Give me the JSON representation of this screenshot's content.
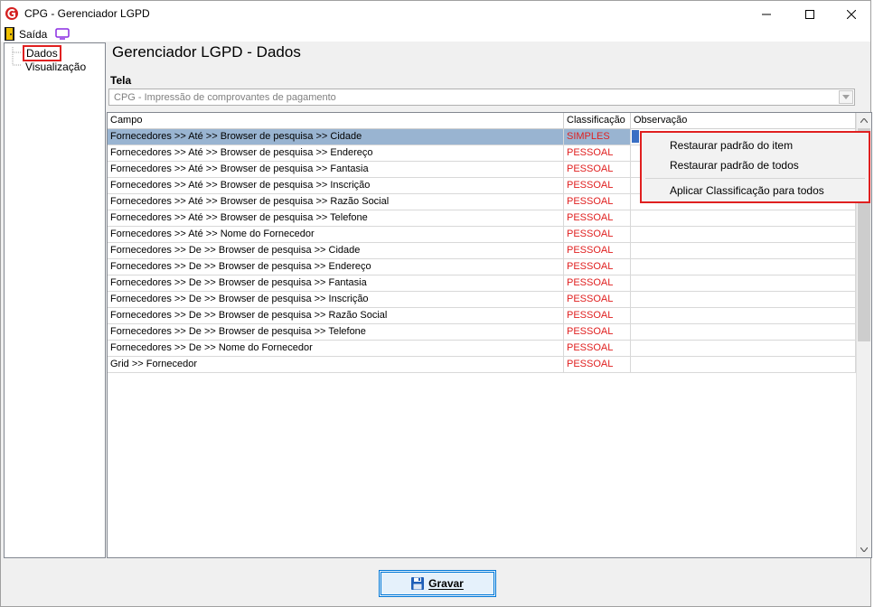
{
  "window": {
    "title": "CPG - Gerenciador LGPD"
  },
  "menubar": {
    "exit_label": "Saída"
  },
  "tree": {
    "items": [
      "Dados",
      "Visualização"
    ]
  },
  "page": {
    "title": "Gerenciador LGPD - Dados"
  },
  "tela": {
    "label": "Tela",
    "value": "CPG - Impressão de comprovantes de pagamento"
  },
  "grid": {
    "columns": [
      "Campo",
      "Classificação",
      "Observação"
    ],
    "rows": [
      {
        "campo": "Fornecedores >> Até >> Browser de pesquisa >> Cidade",
        "classificacao": "SIMPLES",
        "observacao": ""
      },
      {
        "campo": "Fornecedores >> Até >> Browser de pesquisa >> Endereço",
        "classificacao": "PESSOAL",
        "observacao": ""
      },
      {
        "campo": "Fornecedores >> Até >> Browser de pesquisa >> Fantasia",
        "classificacao": "PESSOAL",
        "observacao": ""
      },
      {
        "campo": "Fornecedores >> Até >> Browser de pesquisa >> Inscrição",
        "classificacao": "PESSOAL",
        "observacao": ""
      },
      {
        "campo": "Fornecedores >> Até >> Browser de pesquisa >> Razão Social",
        "classificacao": "PESSOAL",
        "observacao": ""
      },
      {
        "campo": "Fornecedores >> Até >> Browser de pesquisa >> Telefone",
        "classificacao": "PESSOAL",
        "observacao": ""
      },
      {
        "campo": "Fornecedores >> Até >> Nome do Fornecedor",
        "classificacao": "PESSOAL",
        "observacao": ""
      },
      {
        "campo": "Fornecedores >> De >> Browser de pesquisa >> Cidade",
        "classificacao": "PESSOAL",
        "observacao": ""
      },
      {
        "campo": "Fornecedores >> De >> Browser de pesquisa >> Endereço",
        "classificacao": "PESSOAL",
        "observacao": ""
      },
      {
        "campo": "Fornecedores >> De >> Browser de pesquisa >> Fantasia",
        "classificacao": "PESSOAL",
        "observacao": ""
      },
      {
        "campo": "Fornecedores >> De >> Browser de pesquisa >> Inscrição",
        "classificacao": "PESSOAL",
        "observacao": ""
      },
      {
        "campo": "Fornecedores >> De >> Browser de pesquisa >> Razão Social",
        "classificacao": "PESSOAL",
        "observacao": ""
      },
      {
        "campo": "Fornecedores >> De >> Browser de pesquisa >> Telefone",
        "classificacao": "PESSOAL",
        "observacao": ""
      },
      {
        "campo": "Fornecedores >> De >> Nome do Fornecedor",
        "classificacao": "PESSOAL",
        "observacao": ""
      },
      {
        "campo": "Grid >> Fornecedor",
        "classificacao": "PESSOAL",
        "observacao": ""
      }
    ]
  },
  "context_menu": {
    "items": [
      "Restaurar padrão do item",
      "Restaurar padrão de todos",
      "Aplicar Classificação para todos"
    ]
  },
  "footer": {
    "save_label": "Gravar"
  },
  "colors": {
    "accent": "#0078d7",
    "highlight": "#e02020",
    "selection": "#99b4d1",
    "classification_text": "#e02020"
  },
  "icons": [
    "app-logo-icon",
    "minimize-icon",
    "maximize-icon",
    "close-icon",
    "exit-door-icon",
    "monitor-icon",
    "dropdown-arrow-icon",
    "scroll-up-icon",
    "scroll-down-icon",
    "floppy-disk-icon"
  ]
}
